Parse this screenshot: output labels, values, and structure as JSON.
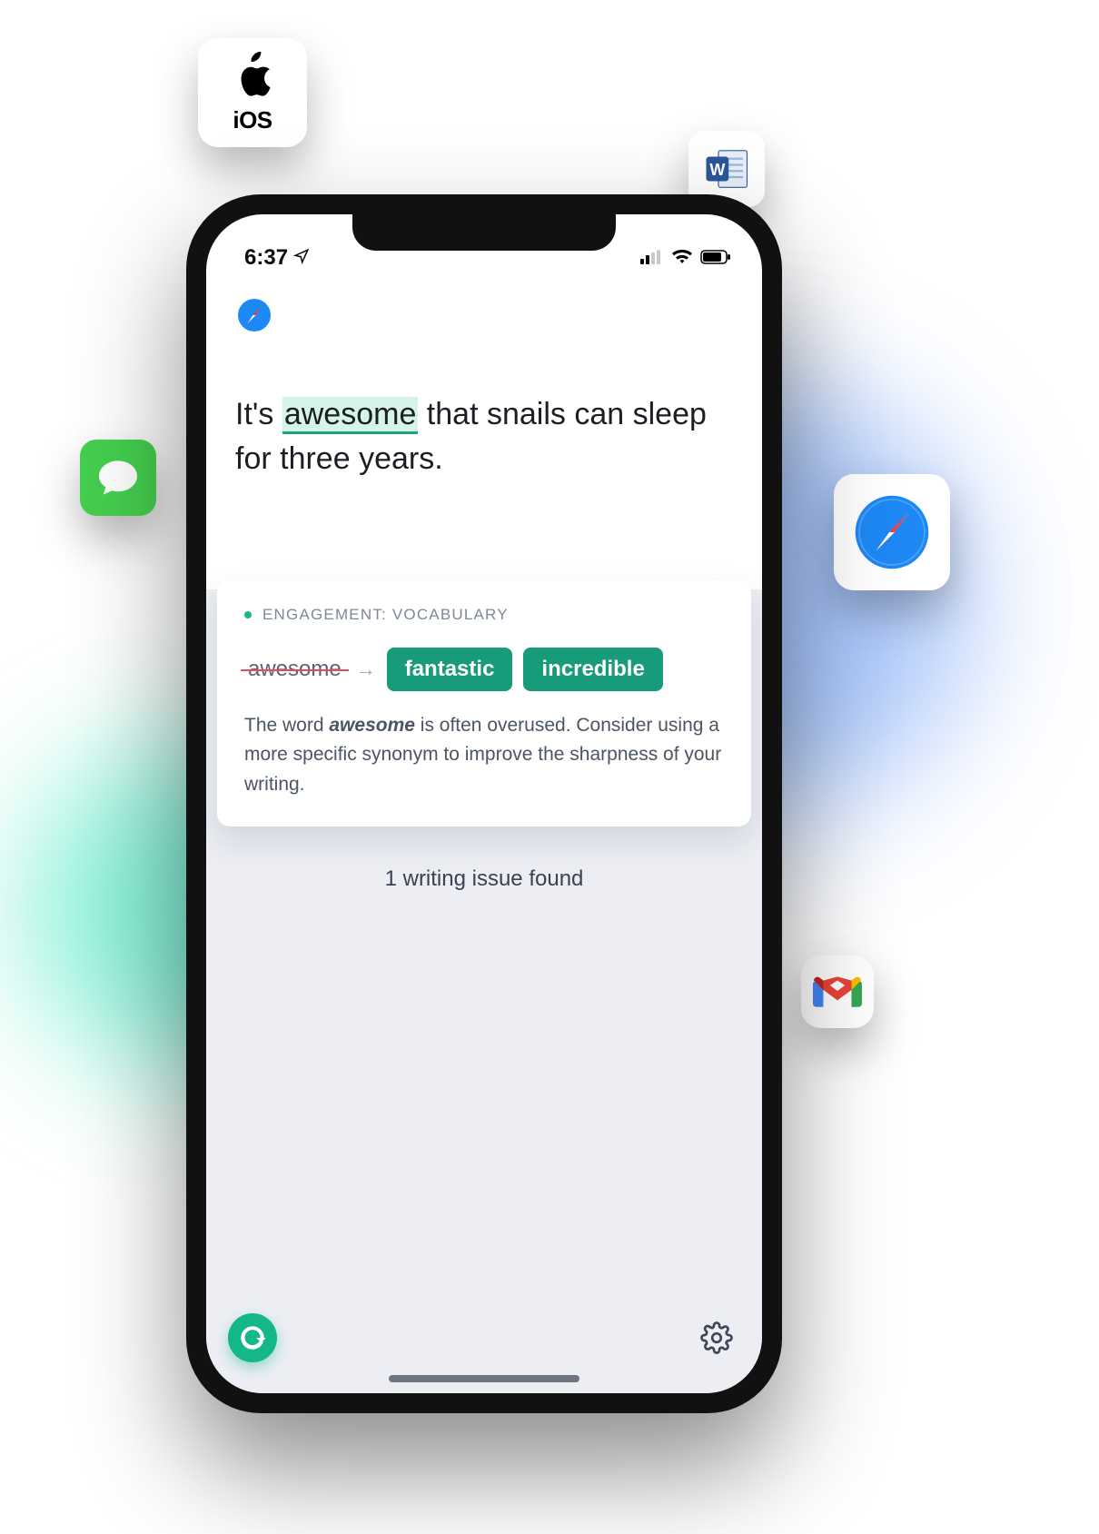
{
  "status": {
    "time": "6:37"
  },
  "editor": {
    "pre": "It's ",
    "highlight": "awesome",
    "post": " that snails can sleep for three years."
  },
  "card": {
    "category": "ENGAGEMENT: VOCABULARY",
    "original": "awesome",
    "suggestions": [
      "fantastic",
      "incredible"
    ],
    "explanation_pre": "The word ",
    "explanation_kw": "awesome",
    "explanation_post": " is often overused. Consider using a more specific synonym to improve the sharpness of your writing."
  },
  "issues_text": "1 writing issue found",
  "chips": {
    "ios_label": "iOS"
  },
  "colors": {
    "accent": "#14b789",
    "brand": "#189b7a"
  }
}
